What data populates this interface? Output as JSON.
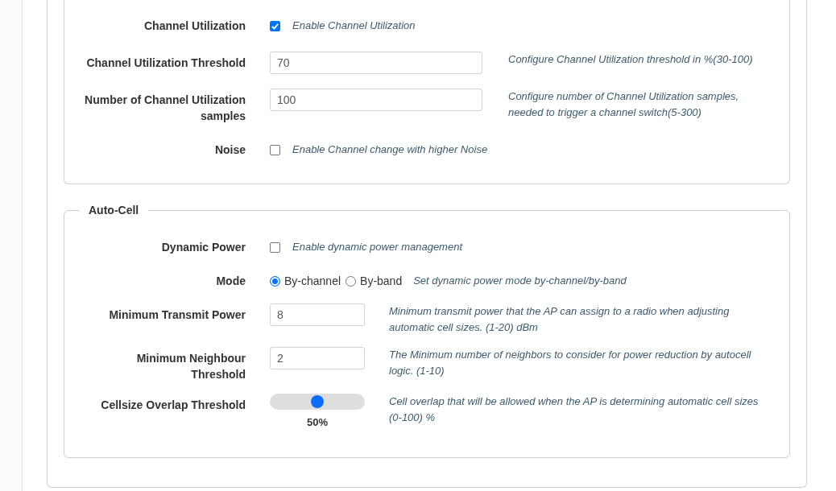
{
  "sections": [
    {
      "rows": [
        {
          "kind": "checkbox",
          "label": "Channel Utilization",
          "checked": true,
          "help": "Enable Channel Utilization"
        },
        {
          "kind": "input",
          "label": "Channel Utilization Threshold",
          "value": "70",
          "help": "Configure Channel Utilization threshold in %(30-100)"
        },
        {
          "kind": "input",
          "label": "Number of Channel Utilization samples",
          "value": "100",
          "help": "Configure number of Channel Utilization samples, needed to trigger a channel switch(5-300)"
        },
        {
          "kind": "checkbox",
          "label": "Noise",
          "checked": false,
          "help": "Enable Channel change with higher Noise"
        }
      ]
    },
    {
      "legend": "Auto-Cell",
      "rows": [
        {
          "kind": "checkbox",
          "label": "Dynamic Power",
          "checked": false,
          "help": "Enable dynamic power management"
        },
        {
          "kind": "radio",
          "label": "Mode",
          "options": [
            {
              "label": "By-channel",
              "selected": true
            },
            {
              "label": "By-band",
              "selected": false
            }
          ],
          "help": "Set dynamic power mode by-channel/by-band"
        },
        {
          "kind": "input",
          "label": "Minimum Transmit Power",
          "value": "8",
          "help": "Minimum transmit power that the AP can assign to a radio when adjusting automatic cell sizes. (1-20) dBm"
        },
        {
          "kind": "input",
          "label": "Minimum Neighbour Threshold",
          "value": "2",
          "help": "The Minimum number of neighbors to consider for power reduction by autocell logic. (1-10)"
        },
        {
          "kind": "slider",
          "label": "Cellsize Overlap Threshold",
          "level": 0.5,
          "reading": "50%",
          "help": "Cell overlap that will be allowed when the AP is determining automatic cell sizes (0-100) %"
        }
      ]
    }
  ]
}
